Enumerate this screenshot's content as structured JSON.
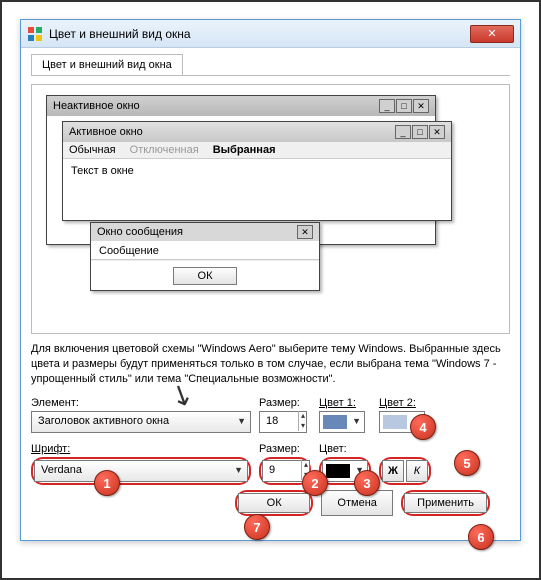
{
  "window": {
    "title": "Цвет и внешний вид окна",
    "tab": "Цвет и внешний вид окна"
  },
  "preview": {
    "inactive_title": "Неактивное окно",
    "active_title": "Активное окно",
    "menu_normal": "Обычная",
    "menu_disabled": "Отключенная",
    "menu_selected": "Выбранная",
    "body_text": "Текст в окне",
    "msgbox_title": "Окно сообщения",
    "msgbox_text": "Сообщение",
    "ok": "ОК"
  },
  "description": "Для включения цветовой схемы \"Windows Aero\" выберите тему Windows. Выбранные здесь цвета и размеры будут применяться только в том случае, если выбрана тема \"Windows 7 - упрощенный стиль\" или тема \"Специальные возможности\".",
  "labels": {
    "element": "Элемент:",
    "size": "Размер:",
    "color1": "Цвет 1:",
    "color2": "Цвет 2:",
    "font": "Шрифт:",
    "color": "Цвет:"
  },
  "values": {
    "element": "Заголовок активного окна",
    "size1": "18",
    "font": "Verdana",
    "size2": "9",
    "color_font": "#000000",
    "color1": "#6888b8",
    "color2": "#b8c8e0",
    "bold": "Ж",
    "italic": "К"
  },
  "buttons": {
    "ok": "ОК",
    "cancel": "Отмена",
    "apply": "Применить"
  },
  "badges": {
    "b1": "1",
    "b2": "2",
    "b3": "3",
    "b4": "4",
    "b5": "5",
    "b6": "6",
    "b7": "7"
  }
}
